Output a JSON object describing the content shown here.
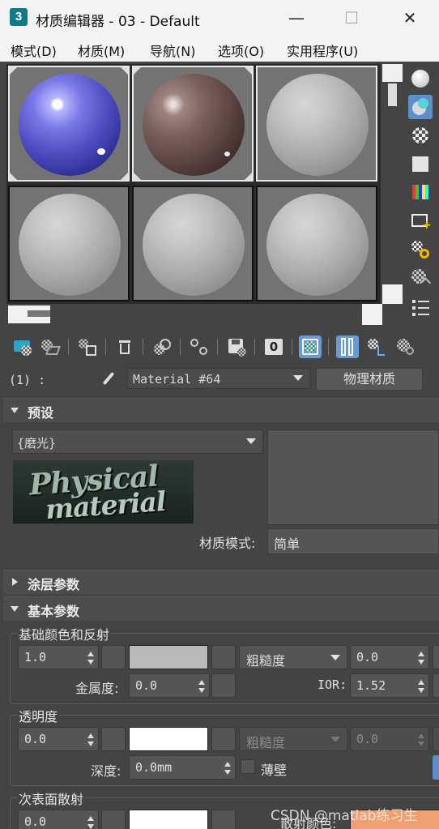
{
  "window": {
    "app_icon_text": "3",
    "title": "材质编辑器 - 03 - Default",
    "minimize": "—",
    "maximize": "☐",
    "close": "✕"
  },
  "menu": [
    "模式(D)",
    "材质(M)",
    "导航(N)",
    "选项(O)",
    "实用程序(U)"
  ],
  "slots": [
    {
      "name": "blue-glossy"
    },
    {
      "name": "brown-granite"
    },
    {
      "name": "default-gray"
    },
    {
      "name": "default-gray"
    },
    {
      "name": "default-gray"
    },
    {
      "name": "default-gray"
    }
  ],
  "name_row": {
    "slot_index": "(1) :",
    "material_name": "Material #64",
    "material_type": "物理材质"
  },
  "presets": {
    "header": "预设",
    "preset_value": "{磨光}",
    "logo_line1": "Physical",
    "logo_line2": "material",
    "mode_label": "材质模式:",
    "mode_value": "简单"
  },
  "coating": {
    "header": "涂层参数"
  },
  "basic": {
    "header": "基本参数",
    "base_group": "基础颜色和反射",
    "base_weight": "1.0",
    "roughness_mode": "粗糙度",
    "roughness_value": "0.0",
    "metalness_label": "金属度:",
    "metalness_value": "0.0",
    "ior_label": "IOR:",
    "ior_value": "1.52",
    "transparency_group": "透明度",
    "trans_weight": "0.0",
    "trans_roughness_mode": "粗糙度",
    "trans_roughness_value": "0.0",
    "depth_label": "深度:",
    "depth_value": "0.0mm",
    "thin_walled_label": "薄壁",
    "sss_group": "次表面散射",
    "sss_weight": "0.0",
    "scatter_color_label": "散射颜色:"
  },
  "watermark": "CSDN @matlab练习生",
  "colors": {
    "base_color": "#b9b9b9",
    "trans_color": "#ffffff",
    "sss_color": "#ffffff",
    "scatter_color": "#f0a070",
    "active_tool": "#5b8fc9"
  }
}
